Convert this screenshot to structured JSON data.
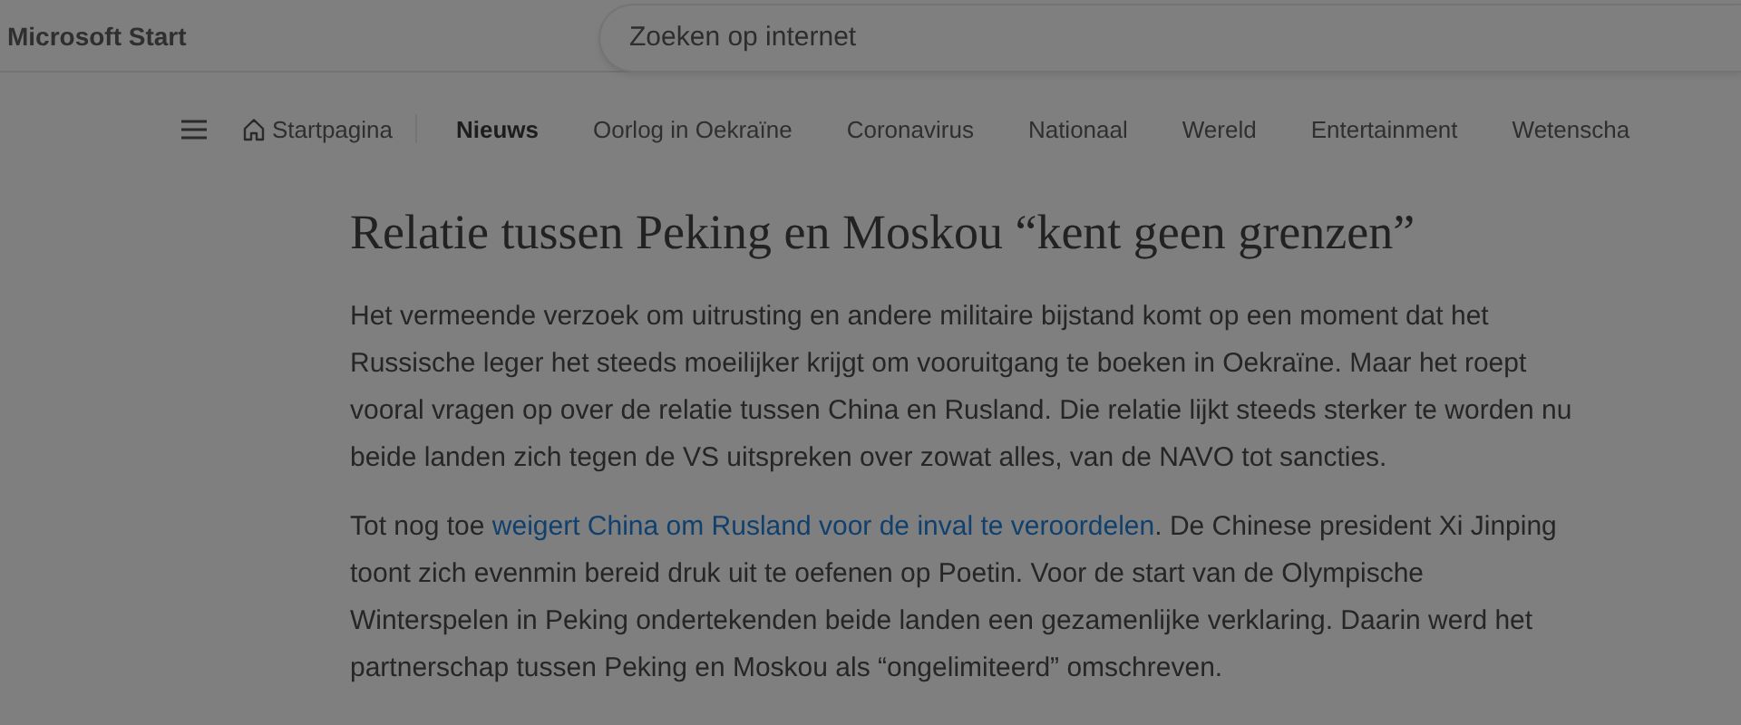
{
  "header": {
    "logo": "Microsoft Start",
    "search": {
      "placeholder": "Zoeken op internet"
    }
  },
  "nav": {
    "items": [
      {
        "label": "Startpagina",
        "kind": "home",
        "selected": false
      },
      {
        "label": "Nieuws",
        "kind": "link",
        "selected": true
      },
      {
        "label": "Oorlog in Oekraïne",
        "kind": "link",
        "selected": false
      },
      {
        "label": "Coronavirus",
        "kind": "link",
        "selected": false
      },
      {
        "label": "Nationaal",
        "kind": "link",
        "selected": false
      },
      {
        "label": "Wereld",
        "kind": "link",
        "selected": false
      },
      {
        "label": "Entertainment",
        "kind": "link",
        "selected": false
      },
      {
        "label": "Wetenscha",
        "kind": "link",
        "selected": false
      }
    ]
  },
  "article": {
    "title": "Relatie tussen Peking en Moskou “kent geen grenzen”",
    "paragraphs": [
      {
        "lines": [
          [
            {
              "kind": "text",
              "text": "Het vermeende verzoek om uitrusting en andere militaire bijstand komt op een moment dat het"
            }
          ],
          [
            {
              "kind": "text",
              "text": "Russische leger het steeds moeilijker krijgt om vooruitgang te boeken in Oekraïne. Maar het roept"
            }
          ],
          [
            {
              "kind": "text",
              "text": "vooral vragen op over de relatie tussen China en Rusland. Die relatie lijkt steeds sterker te worden nu"
            }
          ],
          [
            {
              "kind": "text",
              "text": "beide landen zich tegen de VS uitspreken over zowat alles, van de NAVO tot sancties."
            }
          ]
        ]
      },
      {
        "lines": [
          [
            {
              "kind": "text",
              "text": "Tot nog toe "
            },
            {
              "kind": "link",
              "text": "weigert China om Rusland voor de inval te veroordelen"
            },
            {
              "kind": "text",
              "text": ". De Chinese president Xi Jinping"
            }
          ],
          [
            {
              "kind": "text",
              "text": "toont zich evenmin bereid druk uit te oefenen op Poetin. Voor de start van de Olympische"
            }
          ],
          [
            {
              "kind": "text",
              "text": "Winterspelen in Peking ondertekenden beide landen een gezamenlijke verklaring. Daarin werd het"
            }
          ],
          [
            {
              "kind": "text",
              "text": "partnerschap tussen Peking en Moskou als “ongelimiteerd” omschreven."
            }
          ]
        ]
      }
    ]
  }
}
